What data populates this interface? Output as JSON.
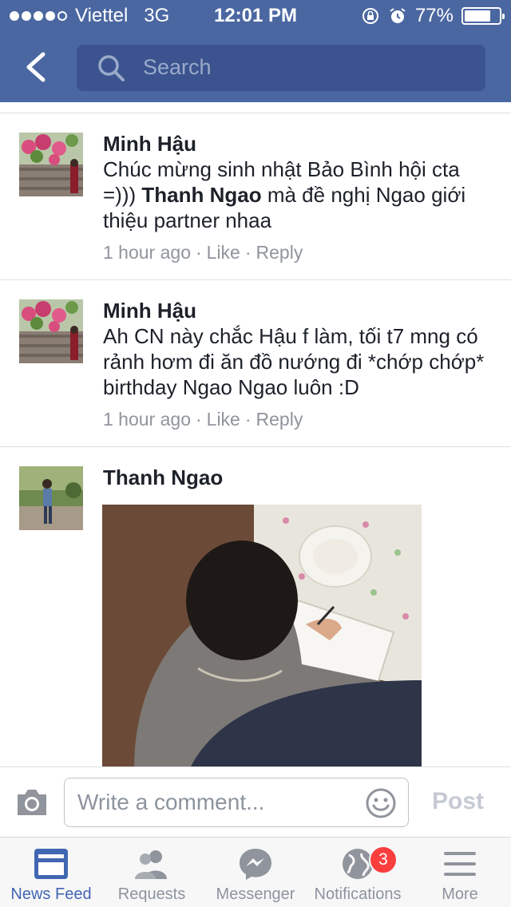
{
  "status_bar": {
    "carrier": "Viettel",
    "network": "3G",
    "time": "12:01 PM",
    "battery": "77%",
    "battery_level": 0.77
  },
  "header": {
    "search_placeholder": "Search"
  },
  "comments": [
    {
      "author": "Minh Hậu",
      "text_before": "Chúc mừng sinh nhật Bảo Bình hội cta =))) ",
      "mention": "Thanh Ngao",
      "text_after": " mà đề nghị Ngao giới thiệu partner nhaa",
      "time": "1 hour ago",
      "like": "Like",
      "reply": "Reply"
    },
    {
      "author": "Minh Hậu",
      "text": "Ah CN này chắc Hậu f làm, tối t7 mng có rảnh hơm đi ăn đồ nướng đi *chớp chớp* birthday Ngao Ngao luôn :D",
      "time": "1 hour ago",
      "like": "Like",
      "reply": "Reply"
    },
    {
      "author": "Thanh Ngao"
    }
  ],
  "comment_bar": {
    "placeholder": "Write a comment...",
    "post_label": "Post"
  },
  "tabs": [
    {
      "label": "News Feed",
      "icon": "news-feed-icon",
      "active": true
    },
    {
      "label": "Requests",
      "icon": "friend-requests-icon"
    },
    {
      "label": "Messenger",
      "icon": "messenger-icon"
    },
    {
      "label": "Notifications",
      "icon": "globe-icon",
      "badge": "3"
    },
    {
      "label": "More",
      "icon": "menu-icon"
    }
  ],
  "colors": {
    "brand": "#4b67a1",
    "active_tab": "#4267b2",
    "badge": "#fa3e3e"
  }
}
